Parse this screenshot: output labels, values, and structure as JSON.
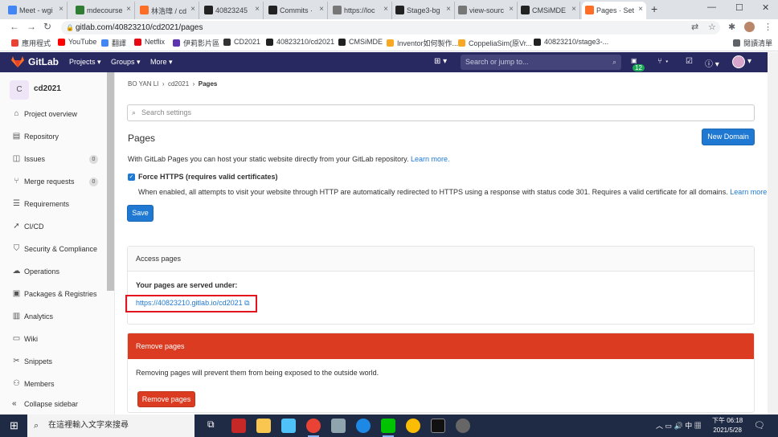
{
  "browser": {
    "tabs": [
      {
        "label": "Meet - wgi",
        "color": "#4285f4"
      },
      {
        "label": "mdecourse",
        "color": "#2e7d32"
      },
      {
        "label": "林浩瑋 / cd",
        "color": "#fc6d26"
      },
      {
        "label": "40823245",
        "color": "#222"
      },
      {
        "label": "Commits ·",
        "color": "#222"
      },
      {
        "label": "https://loc",
        "color": "#777"
      },
      {
        "label": "Stage3-bg",
        "color": "#222"
      },
      {
        "label": "view-sourc",
        "color": "#777"
      },
      {
        "label": "CMSiMDE",
        "color": "#222"
      },
      {
        "label": "Pages · Set",
        "color": "#fc6d26"
      }
    ],
    "new_tab": "+",
    "url": "gitlab.com/40823210/cd2021/pages",
    "bookmarks": [
      {
        "label": "應用程式",
        "color": "#ea4335"
      },
      {
        "label": "YouTube",
        "color": "#ff0000"
      },
      {
        "label": "翻譯",
        "color": "#4285f4"
      },
      {
        "label": "Netflix",
        "color": "#e50914"
      },
      {
        "label": "伊莉影片區",
        "color": "#5e35b1"
      },
      {
        "label": "CD2021",
        "color": "#333"
      },
      {
        "label": "40823210/cd2021",
        "color": "#222"
      },
      {
        "label": "CMSiMDE",
        "color": "#222"
      },
      {
        "label": "Inventor如何製作...",
        "color": "#f9a825"
      },
      {
        "label": "CoppeliaSim(原Vr...",
        "color": "#f9a825"
      },
      {
        "label": "40823210/stage3-...",
        "color": "#222"
      }
    ],
    "reading_list": "閱讀清單"
  },
  "gitlab": {
    "brand": "GitLab",
    "menus": [
      "Projects",
      "Groups",
      "More"
    ],
    "search_placeholder": "Search or jump to...",
    "todo_count": "12"
  },
  "sidebar": {
    "project_initial": "C",
    "project_name": "cd2021",
    "items": [
      {
        "label": "Project overview",
        "icon": "home-icon",
        "glyph": "⌂"
      },
      {
        "label": "Repository",
        "icon": "book-icon",
        "glyph": "▤"
      },
      {
        "label": "Issues",
        "icon": "issues-icon",
        "glyph": "◫",
        "badge": "0"
      },
      {
        "label": "Merge requests",
        "icon": "merge-request-icon",
        "glyph": "⑂",
        "badge": "0"
      },
      {
        "label": "Requirements",
        "icon": "requirements-icon",
        "glyph": "☰"
      },
      {
        "label": "CI/CD",
        "icon": "rocket-icon",
        "glyph": "➚"
      },
      {
        "label": "Security & Compliance",
        "icon": "shield-icon",
        "glyph": "⛉"
      },
      {
        "label": "Operations",
        "icon": "cloud-icon",
        "glyph": "☁"
      },
      {
        "label": "Packages & Registries",
        "icon": "package-icon",
        "glyph": "▣"
      },
      {
        "label": "Analytics",
        "icon": "chart-icon",
        "glyph": "▥"
      },
      {
        "label": "Wiki",
        "icon": "wiki-icon",
        "glyph": "▭"
      },
      {
        "label": "Snippets",
        "icon": "snippet-icon",
        "glyph": "✂"
      },
      {
        "label": "Members",
        "icon": "users-icon",
        "glyph": "⚇"
      }
    ],
    "collapse_label": "Collapse sidebar"
  },
  "breadcrumb": {
    "owner": "BO YAN LI",
    "project": "cd2021",
    "current": "Pages"
  },
  "settings_search_placeholder": "Search settings",
  "pages": {
    "title": "Pages",
    "new_domain": "New Domain",
    "intro": "With GitLab Pages you can host your static website directly from your GitLab repository.",
    "learn_more": "Learn more.",
    "force_https_label": "Force HTTPS (requires valid certificates)",
    "force_https_help": "When enabled, all attempts to visit your website through HTTP are automatically redirected to HTTPS using a response with status code 301. Requires a valid certificate for all domains.",
    "save": "Save",
    "access_title": "Access pages",
    "served_label": "Your pages are served under:",
    "page_url": "https://40823210.gitlab.io/cd2021",
    "remove_title": "Remove pages",
    "remove_text": "Removing pages will prevent them from being exposed to the outside world.",
    "remove_button": "Remove pages"
  },
  "taskbar": {
    "search_placeholder": "在這裡輸入文字來搜尋",
    "time": "下午 06:18",
    "date": "2021/5/28"
  }
}
